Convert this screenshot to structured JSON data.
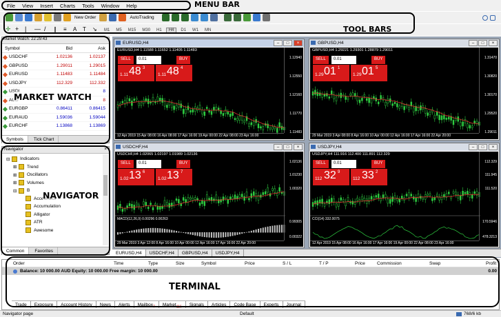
{
  "annotations": {
    "menu_bar": "MENU BAR",
    "tool_bars": "TOOL BARS",
    "market_watch": "MARKET WATCH",
    "navigator": "NAVIGATOR",
    "terminal": "TERMINAL"
  },
  "menu": [
    "File",
    "View",
    "Insert",
    "Charts",
    "Tools",
    "Window",
    "Help"
  ],
  "toolbar": {
    "new_order": "New Order",
    "autotrading": "AutoTrading",
    "timeframes": [
      "M1",
      "M5",
      "M15",
      "M30",
      "H1",
      "H4",
      "D1",
      "W1",
      "MN"
    ]
  },
  "market_watch": {
    "title": "Market Watch: 22:29:43",
    "headers": [
      "Symbol",
      "Bid",
      "Ask"
    ],
    "rows": [
      {
        "symbol": "USDCHF",
        "bid": "1.02136",
        "ask": "1.02137",
        "dir": "down"
      },
      {
        "symbol": "GBPUSD",
        "bid": "1.29011",
        "ask": "1.29015",
        "dir": "down"
      },
      {
        "symbol": "EURUSD",
        "bid": "1.11483",
        "ask": "1.11484",
        "dir": "down"
      },
      {
        "symbol": "USDJPY",
        "bid": "112.329",
        "ask": "112.332",
        "dir": "down"
      },
      {
        "symbol": "USDI",
        "bid": "",
        "ask": "8",
        "dir": "up"
      },
      {
        "symbol": "AUD",
        "bid": "",
        "ask": "8",
        "dir": "down"
      },
      {
        "symbol": "EURGBP",
        "bid": "0.86411",
        "ask": "0.86415",
        "dir": "up"
      },
      {
        "symbol": "EURAUD",
        "bid": "1.59036",
        "ask": "1.59044",
        "dir": "up"
      },
      {
        "symbol": "EURCHF",
        "bid": "1.13868",
        "ask": "1.13869",
        "dir": "up"
      }
    ],
    "tabs": [
      "Symbols",
      "Tick Chart"
    ]
  },
  "navigator": {
    "title": "Navigator",
    "items": [
      "Indicators",
      "Trend",
      "Oscillators",
      "Volumes",
      "B",
      "Accelerator",
      "Accumulation",
      "Alligator",
      "ATR",
      "Awesome"
    ],
    "tabs": [
      "Common",
      "Favorites"
    ]
  },
  "charts": [
    {
      "title": "EURUSD,H4",
      "info": "EURUSD,H4  1.11588 1.11652 1.11405 1.11483",
      "lot": "0.01",
      "sell_small": "1.11",
      "sell_big": "48",
      "sell_sup": "3",
      "buy_small": "1.11",
      "buy_big": "48",
      "buy_sup": "4",
      "yticks": [
        "1.12940",
        "1.12550",
        "1.12160",
        "1.11770",
        "1.11483"
      ],
      "xticks": "12 Apr 2019   15 Apr 08:00   16 Apr 08:00   17 Apr 16:00   19 Apr 00:00   22 Apr 08:00   23 Apr 16:00"
    },
    {
      "title": "GBPUSD,H4",
      "info": "GBPUSD,H4  1.29221 1.29301 1.28879 1.29011",
      "lot": "0.01",
      "sell_small": "1.29",
      "sell_big": "01",
      "sell_sup": "1",
      "buy_small": "1.29",
      "buy_big": "01",
      "buy_sup": "5",
      "yticks": [
        "1.31470",
        "1.30820",
        "1.30170",
        "1.29520",
        "1.29011"
      ],
      "xticks": "29 Mar 2019   3 Apr 08:00   8 Apr 16:00   10 Apr 00:00   12 Apr 16:00   17 Apr 16:00   22 Apr 20:00"
    },
    {
      "title": "USDCHF,H4",
      "info": "USDCHF,H4  1.02065 1.02197 1.01989 1.02136",
      "lot": "0.01",
      "sell_small": "1.02",
      "sell_big": "13",
      "sell_sup": "6",
      "buy_small": "1.02",
      "buy_big": "13",
      "buy_sup": "7",
      "yticks": [
        "1.02136",
        "1.01230",
        "1.00320",
        "0.99305",
        "0.00322"
      ],
      "macd": "MACD(12,26,9) 0.00296 0.00263",
      "xticks": "29 Mar 2019   3 Apr 12:00   8 Apr 16:00   10 Apr 00:00   12 Apr 16:00   17 Apr 16:00   22 Apr 20:00"
    },
    {
      "title": "USDJPY,H4",
      "info": "USDJPY,H4  111.916 112.400 111.891 112.329",
      "lot": "0.01",
      "sell_small": "112",
      "sell_big": "32",
      "sell_sup": "9",
      "buy_small": "112",
      "buy_big": "33",
      "buy_sup": "2",
      "yticks": [
        "112.329",
        "111.945",
        "111.520",
        "170.5946",
        "478.3213"
      ],
      "cci": "CCI(14) 332.0075",
      "xticks": "12 Apr 2019   15 Apr 08:00   16 Apr 16:00   17 Apr 16:00   19 Apr 00:00   22 Apr 08:00   23 Apr 16:00"
    }
  ],
  "chart_tabs": [
    "EURUSD,H4",
    "USDCHF,H4",
    "GBPUSD,H4",
    "USDJPY,H4"
  ],
  "terminal": {
    "headers": [
      "Order",
      "Time",
      "Type",
      "Size",
      "Symbol",
      "Price",
      "S / L",
      "T / P",
      "Price",
      "Commission",
      "Swap",
      "Profit"
    ],
    "balance": "Balance: 10 000.00 AUD  Equity: 10 000.00  Free margin: 10 000.00",
    "profit": "0.00",
    "tabs": [
      "Trade",
      "Exposure",
      "Account History",
      "News",
      "Alerts",
      "Mailbox",
      "Market",
      "Signals",
      "Articles",
      "Code Base",
      "Experts",
      "Journal"
    ],
    "mailbox_badge": "7",
    "market_badge": "116"
  },
  "status": {
    "left": "Navigator page",
    "mid": "Default",
    "right": "768/6 kb"
  }
}
